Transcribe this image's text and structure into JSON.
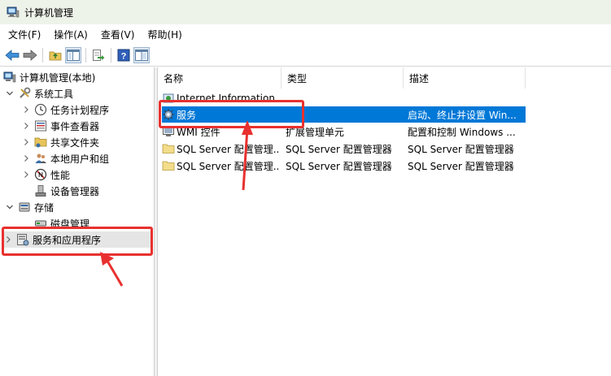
{
  "window": {
    "title": "计算机管理"
  },
  "menu": [
    "文件(F)",
    "操作(A)",
    "查看(V)",
    "帮助(H)"
  ],
  "toolbar": [
    "back-icon",
    "forward-icon",
    "up-folder-icon",
    "show-hide-tree-icon",
    "export-list-icon",
    "help-icon",
    "properties-icon"
  ],
  "tree": {
    "root": "计算机管理(本地)",
    "system_tools": "系统工具",
    "items": [
      "任务计划程序",
      "事件查看器",
      "共享文件夹",
      "本地用户和组",
      "性能",
      "设备管理器"
    ],
    "storage": "存储",
    "disk": "磁盘管理",
    "services_apps": "服务和应用程序"
  },
  "list": {
    "headers": {
      "name": "名称",
      "type": "类型",
      "desc": "描述"
    },
    "rows": [
      {
        "name": "Internet Information...",
        "type": "",
        "desc": "",
        "icon": "iis-icon"
      },
      {
        "name": "服务",
        "type": "",
        "desc": "启动、终止并设置 Win...",
        "icon": "services-gear-icon"
      },
      {
        "name": "WMI 控件",
        "type": "扩展管理单元",
        "desc": "配置和控制 Windows ...",
        "icon": "wmi-icon"
      },
      {
        "name": "SQL Server 配置管理...",
        "type": "SQL Server 配置管理器",
        "desc": "SQL Server 配置管理器",
        "icon": "folder-icon"
      },
      {
        "name": "SQL Server 配置管理...",
        "type": "SQL Server 配置管理器",
        "desc": "SQL Server 配置管理器",
        "icon": "folder-icon"
      }
    ]
  },
  "colors": {
    "selection": "#0078d7",
    "annotation": "#e8312f",
    "titlebar": "#eef3ea"
  }
}
